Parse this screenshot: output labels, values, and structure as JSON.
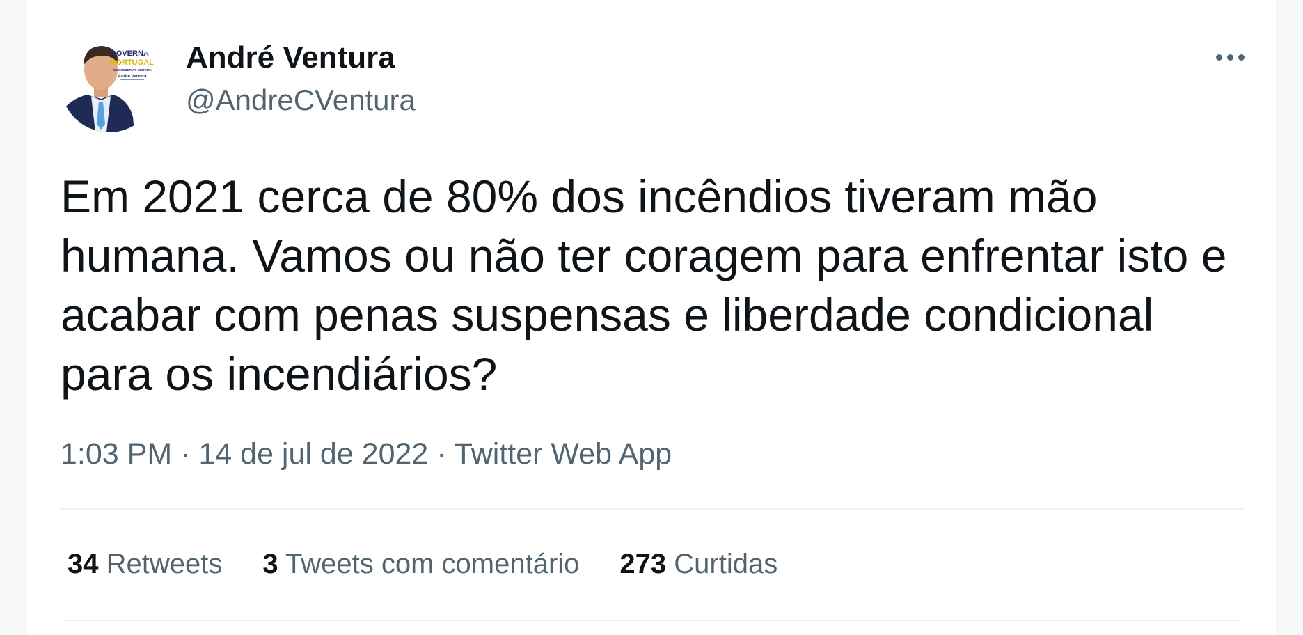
{
  "author": {
    "name": "André Ventura",
    "handle": "@AndreCVentura",
    "avatar_logo_lines": [
      "GOVERNAR",
      "PORTUGAL",
      "SEM CEDER AO SISTEMA",
      "André Ventura"
    ]
  },
  "tweet": {
    "text": "Em 2021 cerca de 80% dos incêndios tiveram mão humana. Vamos ou não ter coragem para enfrentar isto e acabar com penas suspensas e liberdade condicional para os incendiários?",
    "time": "1:03 PM",
    "separator": "·",
    "date": "14 de jul de 2022",
    "source": "Twitter Web App"
  },
  "stats": {
    "retweets_count": "34",
    "retweets_label": "Retweets",
    "quotes_count": "3",
    "quotes_label": "Tweets com comentário",
    "likes_count": "273",
    "likes_label": "Curtidas"
  },
  "colors": {
    "text_primary": "#0f1419",
    "text_secondary": "#536471",
    "divider": "#eff3f4",
    "logo_navy": "#1f2b6b",
    "logo_yellow": "#f2c200"
  },
  "icons": {
    "more": "more-horizontal-icon"
  }
}
